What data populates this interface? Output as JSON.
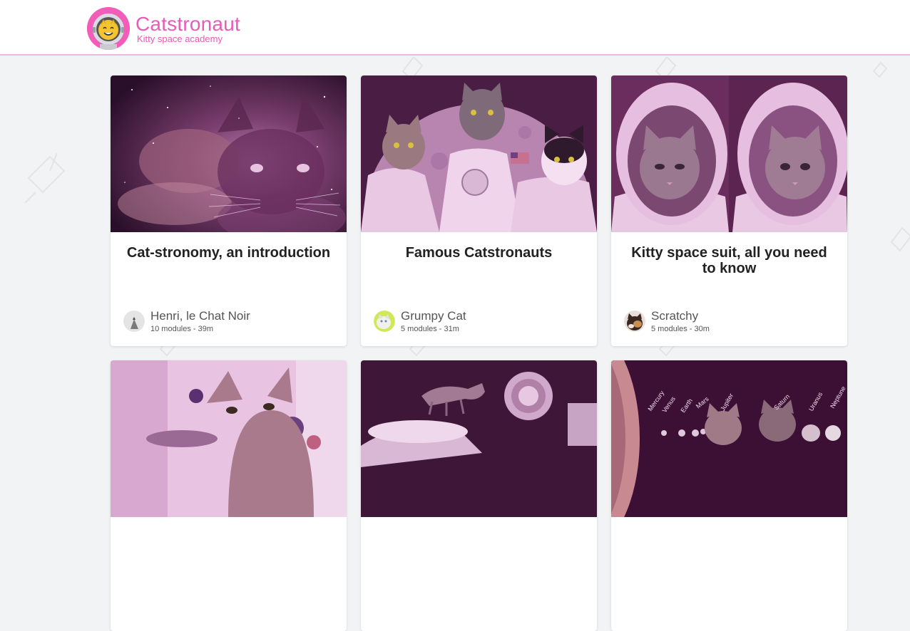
{
  "header": {
    "title": "Catstronaut",
    "subtitle": "Kitty space academy",
    "logo_icon": "astronaut-cat-emoji-icon",
    "accent_color": "#e85bb8"
  },
  "cards": [
    {
      "title": "Cat-stronomy, an introduction",
      "image_icon": "nebula-cat-image",
      "author": {
        "name": "Henri, le Chat Noir",
        "meta": "10 modules - 39m",
        "avatar_icon": "black-cat-avatar"
      }
    },
    {
      "title": "Famous Catstronauts",
      "image_icon": "astronaut-cats-moon-image",
      "author": {
        "name": "Grumpy Cat",
        "meta": "5 modules - 31m",
        "avatar_icon": "grumpy-cat-avatar"
      }
    },
    {
      "title": "Kitty space suit, all you need to know",
      "image_icon": "cats-in-helmets-image",
      "author": {
        "name": "Scratchy",
        "meta": "5 modules - 30m",
        "avatar_icon": "scratchy-cat-avatar"
      }
    },
    {
      "image_icon": "cat-with-planets-image"
    },
    {
      "image_icon": "cat-on-spacecraft-image"
    },
    {
      "image_icon": "solar-system-cats-image",
      "planet_labels": [
        "Mercury",
        "Venus",
        "Earth",
        "Mars",
        "Jupiter",
        "Saturn",
        "Uranus",
        "Neptune"
      ]
    }
  ]
}
